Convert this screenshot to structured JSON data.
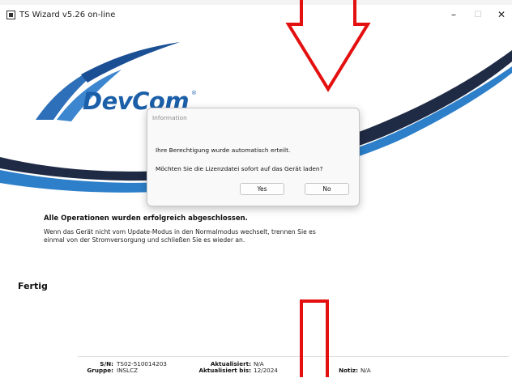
{
  "window": {
    "title": "TS Wizard v5.26 on-line",
    "minimize_glyph": "–",
    "maximize_glyph": "☐",
    "close_glyph": "✕"
  },
  "logo": {
    "text": "DevCom",
    "registered": "®"
  },
  "status": {
    "title": "Alle Operationen wurden erfolgreich abgeschlossen.",
    "text": "Wenn das Gerät nicht vom Update-Modus in den Normalmodus wechselt, trennen Sie es einmal von der Stromversorgung und schließen Sie es wieder an."
  },
  "fertig": "Fertig",
  "device": {
    "sn_label": "S/N:",
    "sn_value": "TS02-510014203",
    "group_label": "Gruppe:",
    "group_value": "INSLCZ",
    "updated_label": "Aktualisiert:",
    "updated_value": "N/A",
    "updated_until_label": "Aktualisiert bis:",
    "updated_until_value": "12/2024",
    "note_label": "Notiz:",
    "note_value": "N/A"
  },
  "dialog": {
    "title": "Information",
    "message1": "Ihre Berechtigung wurde automatisch erteilt.",
    "message2": "Möchten Sie die Lizenzdatei sofort auf das Gerät laden?",
    "yes_label": "Yes",
    "no_label": "No"
  },
  "colors": {
    "brand_blue": "#1b5fa8",
    "stripe_dark": "#1f2a44",
    "annotation_red": "#e41010"
  },
  "icons": [
    "app-icon",
    "minimize-icon",
    "maximize-icon",
    "close-icon",
    "down-arrow-annotation"
  ]
}
